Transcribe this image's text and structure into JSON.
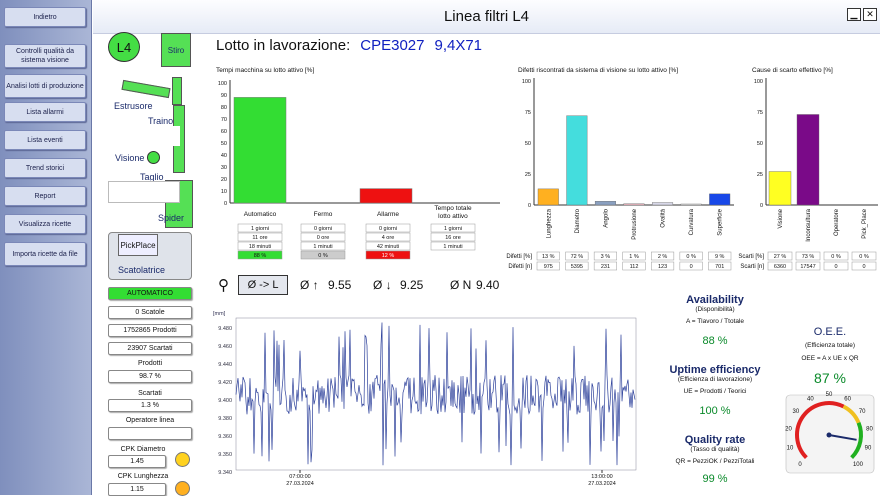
{
  "sidebar": {
    "items": [
      "Indietro",
      "Controlli qualità da sistema visione",
      "Analisi lotti di produzione",
      "Lista allarmi",
      "Lista eventi",
      "Trend storici",
      "Report",
      "Visualizza ricette",
      "Importa ricette da file"
    ]
  },
  "window": {
    "title": "Linea filtri L4",
    "minimize": "▁",
    "close": "✕"
  },
  "machine": {
    "line": "L4",
    "stiro": "Stiro",
    "estrusore": "Estrusore",
    "traino": "Traino",
    "visione": "Visione",
    "taglio": "Taglio",
    "spider": "Spider",
    "pickplace": "PickPlace",
    "scatolatrice": "Scatolatrice"
  },
  "panel": {
    "mode": "AUTOMATICO",
    "scatole": "0 Scatole",
    "prodotti": "1752865 Prodotti",
    "scartati": "23907 Scartati",
    "prodotti_lbl": "Prodotti",
    "prodotti_pct": "98.7 %",
    "scartati_lbl": "Scartati",
    "scartati_pct": "1.3 %",
    "operatore_lbl": "Operatore linea",
    "operatore": "",
    "cpk_diam_lbl": "CPK Diametro",
    "cpk_diam": "1.45",
    "cpk_lung_lbl": "CPK Lunghezza",
    "cpk_lung": "1.15"
  },
  "lot": {
    "label": "Lotto in lavorazione:",
    "code": "CPE3027",
    "size": "9,4X71"
  },
  "diam": {
    "button": "Ø -> L",
    "max_lbl": "Ø ↑",
    "max": "9.55",
    "min_lbl": "Ø ↓",
    "min": "9.25",
    "nom_lbl": "Ø N",
    "nom": "9.40"
  },
  "stats": {
    "avail": {
      "h": "Availability",
      "s1": "(Disponibilità)",
      "s2": "A = Tlavoro / Ttotale",
      "p": "88 %"
    },
    "uptime": {
      "h": "Uptime efficiency",
      "s1": "(Efficienza di lavorazione)",
      "s2": "UE = Prodotti / Teorici",
      "p": "100 %"
    },
    "quality": {
      "h": "Quality rate",
      "s1": "(Tasso di qualità)",
      "s2": "QR = PezziOK / PezziTotali",
      "p": "99 %"
    },
    "oee": {
      "h": "O.E.E.",
      "s1": "(Efficienza totale)",
      "s2": "OEE = A x UE x QR",
      "p": "87 %"
    }
  },
  "colors": {
    "green": "#33dd33",
    "red": "#ee1111",
    "cyan": "#44dddd",
    "purple": "#7a0a88",
    "yellow": "#ffff22",
    "orange": "#ffb020",
    "slate": "#8aa0c0",
    "pink": "#f4b8c4",
    "blue": "#1848e8",
    "line": "#2b3f9a"
  },
  "chart_data": [
    {
      "type": "bar",
      "title": "Tempi macchina su lotto attivo [%]",
      "categories": [
        "Automatico",
        "Fermo",
        "Allarme",
        "Tempo totale lotto attivo"
      ],
      "values": [
        88,
        0,
        12,
        null
      ],
      "ylim": [
        0,
        100
      ],
      "yticks": [
        0,
        10,
        20,
        30,
        40,
        50,
        60,
        70,
        80,
        90,
        100
      ],
      "tables": [
        [
          "1 giorni",
          "11 ore",
          "18 minuti",
          "88 %"
        ],
        [
          "0 giorni",
          "0 ore",
          "1 minuti",
          "0 %"
        ],
        [
          "0 giorni",
          "4 ore",
          "42 minuti",
          "12 %"
        ],
        [
          "1 giorni",
          "16 ore",
          "1 minuti"
        ]
      ]
    },
    {
      "type": "bar",
      "title": "Difetti riscontrati da sistema di visione su lotto attivo [%]",
      "categories": [
        "Lunghezza",
        "Diametro",
        "Angolo",
        "Protrusione",
        "Ovalità",
        "Curvatura",
        "Superficie"
      ],
      "values": [
        13,
        72,
        3,
        1,
        2,
        0,
        9
      ],
      "counts": [
        "975",
        "5395",
        "231",
        "112",
        "123",
        "0",
        "701"
      ],
      "pct": [
        "13 %",
        "72 %",
        "3 %",
        "1 %",
        "2 %",
        "0 %",
        "9 %"
      ],
      "row1": "Difetti [%]",
      "row2": "Difetti [n]",
      "ylim": [
        0,
        100
      ],
      "yticks": [
        0,
        25,
        50,
        75,
        100
      ]
    },
    {
      "type": "bar",
      "title": "Cause di scarto effettivo [%]",
      "categories": [
        "Visione",
        "Inconsultura",
        "Operatore",
        "Pick_Place"
      ],
      "values": [
        27,
        73,
        0,
        0
      ],
      "counts": [
        "6360",
        "17547",
        "0",
        "0"
      ],
      "pct": [
        "27 %",
        "73 %",
        "0 %",
        "0 %"
      ],
      "row1": "Scarti [%]",
      "row2": "Scarti [n]",
      "ylim": [
        0,
        100
      ],
      "yticks": [
        0,
        25,
        50,
        75,
        100
      ]
    },
    {
      "type": "line",
      "ylabel": "[mm]",
      "ylim": [
        9.33,
        9.48
      ],
      "yticks": [
        "9.340",
        "9.350",
        "9.360",
        "9.380",
        "9.400",
        "9.420",
        "9.440",
        "9.460",
        "9.480"
      ],
      "xticks": [
        [
          "07:00:00",
          "27.03.2024"
        ],
        [
          "13:00:00",
          "27.03.2024"
        ]
      ]
    },
    {
      "type": "gauge",
      "value": 87,
      "ticks": [
        "0",
        "10",
        "20",
        "30",
        "40",
        "50",
        "60",
        "70",
        "80",
        "90",
        "100"
      ]
    }
  ]
}
